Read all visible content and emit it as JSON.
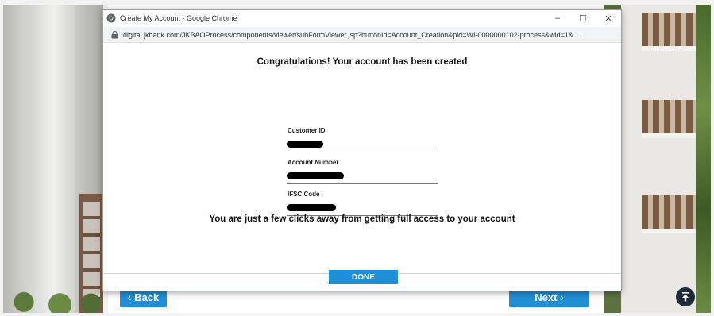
{
  "window": {
    "title": "Create My Account - Google Chrome",
    "url": "digital.jkbank.com/JKBAOProcess/components/viewer/subFormViewer.jsp?buttonId=Account_Creation&pid=WI-0000000102-process&wid=1&...",
    "minimize_glyph": "–",
    "maximize_glyph": "☐",
    "close_glyph": "✕"
  },
  "content": {
    "heading": "Congratulations! Your account has been created",
    "fields": [
      {
        "label": "Customer ID",
        "value_redacted": true
      },
      {
        "label": "Account Number",
        "value_redacted": true
      },
      {
        "label": "IFSC Code",
        "value_redacted": true
      }
    ],
    "subtext": "You are just a few clicks away from getting full access to your account",
    "done_label": "DONE"
  },
  "background_page": {
    "back_label": "Back",
    "back_chevron": "‹",
    "next_label": "Next",
    "next_chevron": "›"
  },
  "icons": {
    "window_icon": "chrome-icon",
    "address_icon": "lock-icon",
    "scroll_top": "arrow-up-to-top-icon"
  },
  "colors": {
    "accent": "#1f8fd6",
    "field_underline": "#2c8fd0"
  }
}
